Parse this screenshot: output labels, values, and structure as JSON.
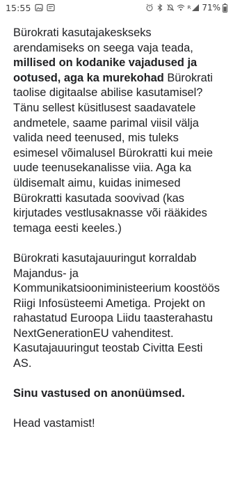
{
  "status_bar": {
    "time": "15:55",
    "net_label": "R",
    "battery_text": "71%"
  },
  "content": {
    "p1_intro": "Bürokrati kasutajakeskseks arendamiseks on seega vaja teada, ",
    "p1_bold": "millised on kodanike vajadused ja ootused, aga ka murekohad",
    "p1_rest": " Bürokrati taolise digitaalse abilise kasutamisel? Tänu sellest küsitlusest saadavatele andmetele, saame parimal viisil välja valida need teenused, mis tuleks esimesel võimalusel Bürokratti kui meie uude teenusekanalisse viia. Aga ka üldisemalt aimu, kuidas inimesed Bürokratti kasutada soovivad (kas kirjutades vestlusaknasse või rääkides temaga eesti keeles.)",
    "p2": "Bürokrati kasutajauuringut korraldab Majandus- ja Kommunikatsiooniministeerium koostöös Riigi Infosüsteemi Ametiga. Projekt on rahastatud Euroopa Liidu taasterahastu NextGenerationEU vahenditest. Kasutajauuringut teostab Civitta Eesti AS.",
    "p3_bold": "Sinu vastused on anonüümsed.",
    "p4": "Head vastamist!"
  }
}
